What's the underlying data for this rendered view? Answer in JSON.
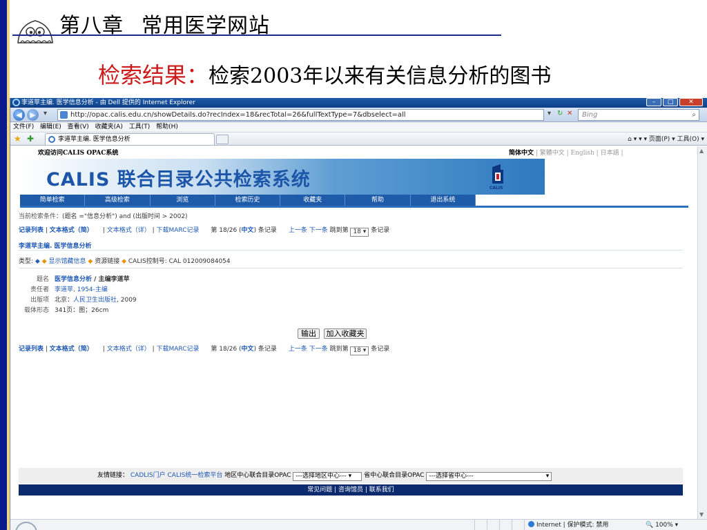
{
  "slide": {
    "title_part1": "第八章",
    "title_part2": "常用医学网站",
    "subtitle_red": "检索结果：",
    "subtitle_black": "检索2003年以来有关信息分析的图书"
  },
  "browser": {
    "window_title": "李道苹主编. 医学信息分析 - 由 Dell 提供的 Internet Explorer",
    "url": "http://opac.calis.edu.cn/showDetails.do?recIndex=18&recTotal=26&fullTextType=7&dbselect=all",
    "search_placeholder": "Bing",
    "menu": "文件(F) 编辑(E) 查看(V) 收藏夹(A) 工具(T) 帮助(H)",
    "tab_label": "李道苹主编. 医学信息分析",
    "command_bar": "▾  ▾  ▾ 页面(P) ▾  工具(O) ▾",
    "status_zone": "Internet | 保护模式: 禁用",
    "zoom": "100%"
  },
  "page": {
    "welcome": "欢迎访问CALIS OPAC系统",
    "lang_active": "简体中文",
    "lang_rest": " | 繁體中文 | English | 日本語 |",
    "banner_title": "CALIS 联合目录公共检索系统",
    "logo_caption": "CALIS",
    "nav": [
      "简单检索",
      "高级检索",
      "浏览",
      "检索历史",
      "收藏夹",
      "帮助",
      "退出系统"
    ],
    "criteria_label": "当前检索条件：",
    "criteria_value": "(题名 =\"信息分析\") and (出版时间 > 2002)",
    "links": {
      "record_list": "记录列表",
      "text_brief": "文本格式（简）",
      "text_full": "文本格式（详）",
      "download_marc": "下载MARC记录",
      "record_pos_prefix": "第 18/26 (",
      "record_pos_lang": "中文",
      "record_pos_suffix": ") 条记录",
      "prev": "上一条",
      "next": "下一条",
      "jump_label": "跳到第",
      "jump_value": "18",
      "jump_suffix": "条记录"
    },
    "record_title": "李道苹主编. 医学信息分析",
    "type_label": "类型:",
    "show_holdings": "显示馆藏信息",
    "resource_link": "资源链接",
    "control_no": "CALIS控制号: CAL 012009084054",
    "fields": [
      {
        "k": "题名",
        "v_link": "医学信息分析",
        "v_rest": " / 主编李道苹"
      },
      {
        "k": "责任者",
        "v_link": "李道苹, 1954-主编",
        "v_rest": ""
      },
      {
        "k": "出版项",
        "v_pre": "北京：",
        "v_link": "人民卫生出版社",
        "v_rest": ", 2009"
      },
      {
        "k": "载体形态",
        "v_rest": "341页：图；26cm"
      }
    ],
    "btn_export": "输出",
    "btn_favorite": "加入收藏夹",
    "friend_label": "友情链接：",
    "friend_links": "CADLIS门户 CALIS统一检索平台",
    "regional_label": "地区中心联合目录OPAC",
    "regional_select": "---选择地区中心---",
    "provincial_label": "省中心联合目录OPAC",
    "provincial_select": "---选择省中心---",
    "footer": "常见问题 | 咨询馆员 | 联系我们"
  },
  "colors": {
    "slide_title_accent": "#cc1a1a",
    "calis_blue": "#1d56a8",
    "link_blue": "#1e58b5",
    "footer_navy": "#0c2a6e"
  }
}
